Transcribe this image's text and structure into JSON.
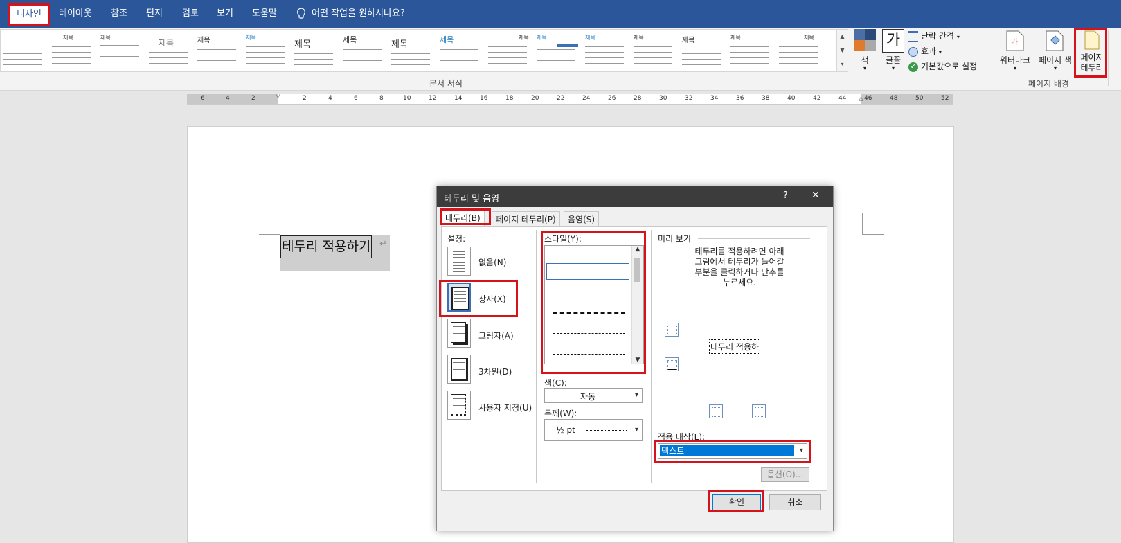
{
  "menu": {
    "items": [
      "디자인",
      "레이아웃",
      "참조",
      "편지",
      "검토",
      "보기",
      "도움말"
    ],
    "search_text": "어떤 작업을 원하시나요?"
  },
  "ribbon": {
    "gallery_label": "문서 서식",
    "gallery_title_word": "제목",
    "gallery_heading_word": "제목 1",
    "color_label": "색",
    "font_label": "글꼴",
    "font_icon_text": "가",
    "paragraph_spacing": "단락 간격",
    "effects": "효과",
    "set_default": "기본값으로 설정",
    "watermark": "워터마크",
    "page_color": "페이지 색",
    "page_border_line1": "페이지",
    "page_border_line2": "테두리",
    "page_background_label": "페이지 배경"
  },
  "ruler": {
    "ticks": [
      "6",
      "4",
      "2",
      "2",
      "4",
      "6",
      "8",
      "10",
      "12",
      "14",
      "16",
      "18",
      "20",
      "22",
      "24",
      "26",
      "28",
      "30",
      "32",
      "34",
      "36",
      "38",
      "40",
      "42",
      "44",
      "46",
      "48",
      "50",
      "52"
    ]
  },
  "document": {
    "selected_text": "테두리 적용하기",
    "paragraph_mark": "↵"
  },
  "dialog": {
    "title": "테두리 및 음영",
    "help": "?",
    "close": "✕",
    "tabs": [
      "테두리(B)",
      "페이지 테두리(P)",
      "음영(S)"
    ],
    "settings_label": "설정:",
    "settings": [
      "없음(N)",
      "상자(X)",
      "그림자(A)",
      "3차원(D)",
      "사용자 지정(U)"
    ],
    "style_label": "스타일(Y):",
    "color_label": "색(C):",
    "color_value": "자동",
    "width_label": "두께(W):",
    "width_value": "½ pt",
    "preview_label": "미리 보기",
    "preview_instructions": [
      "테두리를 적용하려면 아래",
      "그림에서 테두리가 들어갈",
      "부분을 클릭하거나 단추를",
      "누르세요."
    ],
    "preview_text": "테두리 적용하",
    "apply_to_label": "적용 대상(L):",
    "apply_to_value": "텍스트",
    "options_button": "옵션(O)...",
    "ok_button": "확인",
    "cancel_button": "취소"
  },
  "colors": {
    "menubar": "#2b579a",
    "highlight": "#d4131b",
    "selection": "#0078d7"
  }
}
